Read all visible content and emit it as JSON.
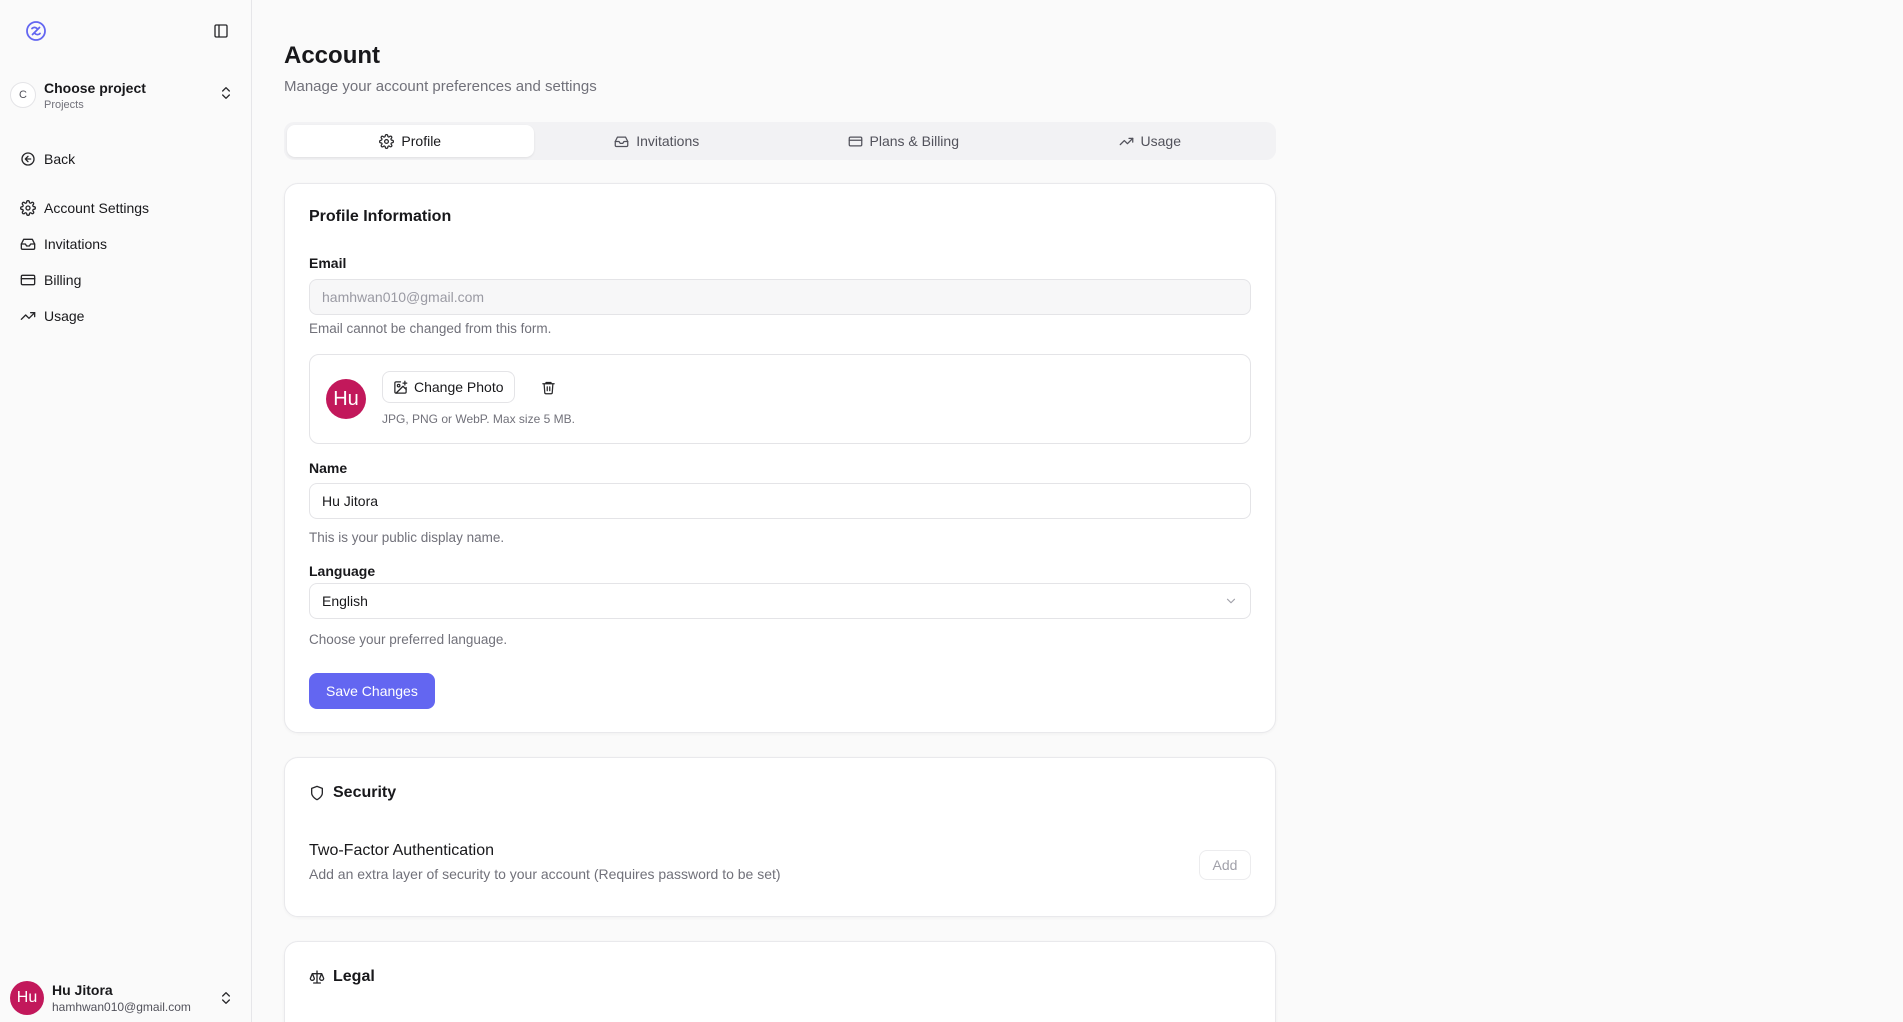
{
  "sidebar": {
    "project": {
      "avatar": "C",
      "name": "Choose project",
      "sub": "Projects"
    },
    "back": "Back",
    "items": [
      {
        "label": "Account Settings",
        "icon": "gear-icon"
      },
      {
        "label": "Invitations",
        "icon": "inbox-icon"
      },
      {
        "label": "Billing",
        "icon": "credit-card-icon"
      },
      {
        "label": "Usage",
        "icon": "trending-up-icon"
      }
    ],
    "user": {
      "initials": "Hu",
      "name": "Hu Jitora",
      "email": "hamhwan010@gmail.com"
    }
  },
  "header": {
    "title": "Account",
    "subtitle": "Manage your account preferences and settings"
  },
  "tabs": [
    {
      "label": "Profile",
      "active": true
    },
    {
      "label": "Invitations",
      "active": false
    },
    {
      "label": "Plans & Billing",
      "active": false
    },
    {
      "label": "Usage",
      "active": false
    }
  ],
  "profile": {
    "title": "Profile Information",
    "email_label": "Email",
    "email_value": "hamhwan010@gmail.com",
    "email_help": "Email cannot be changed from this form.",
    "avatar_initials": "Hu",
    "change_photo_label": "Change Photo",
    "photo_hint": "JPG, PNG or WebP. Max size 5 MB.",
    "name_label": "Name",
    "name_value": "Hu Jitora",
    "name_help": "This is your public display name.",
    "language_label": "Language",
    "language_value": "English",
    "language_help": "Choose your preferred language.",
    "save_label": "Save Changes"
  },
  "security": {
    "title": "Security",
    "tfa_title": "Two-Factor Authentication",
    "tfa_desc": "Add an extra layer of security to your account (Requires password to be set)",
    "add_label": "Add"
  },
  "legal": {
    "title": "Legal"
  },
  "colors": {
    "accent": "#6366f1",
    "avatar": "#c2185b"
  }
}
